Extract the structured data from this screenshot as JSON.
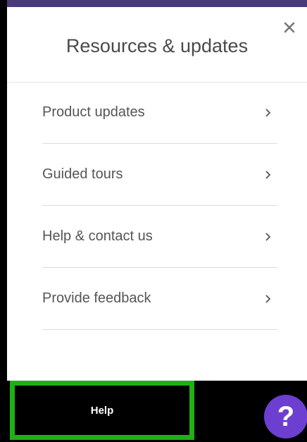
{
  "panel": {
    "title": "Resources & updates",
    "close_icon": "close-icon"
  },
  "menu": {
    "items": [
      {
        "label": "Product updates",
        "icon": "chevron-right-icon"
      },
      {
        "label": "Guided tours",
        "icon": "chevron-right-icon"
      },
      {
        "label": "Help & contact us",
        "icon": "chevron-right-icon"
      },
      {
        "label": "Provide feedback",
        "icon": "chevron-right-icon"
      }
    ]
  },
  "bottom_bar": {
    "help_label": "Help",
    "fab_glyph": "?"
  },
  "colors": {
    "accent_top": "#4a3a7c",
    "help_border": "#1fb016",
    "fab": "#6c3fd0"
  }
}
